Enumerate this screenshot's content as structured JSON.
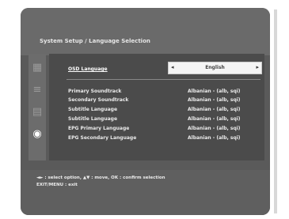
{
  "title": "System Setup / Language Selection",
  "main_setting": {
    "label": "OSD Language",
    "value": "English",
    "left_arrow": "◂",
    "right_arrow": "▸"
  },
  "settings": [
    {
      "label": "Primary Soundtrack",
      "value": "Albanian - (alb, sqi)"
    },
    {
      "label": "Secondary Soundtrack",
      "value": "Albanian - (alb, sqi)"
    },
    {
      "label": "Subtitle Language",
      "value": "Albanian - (alb, sqi)"
    },
    {
      "label": "Subtitle Language",
      "value": "Albanian - (alb, sqi)"
    },
    {
      "label": "EPG Primary Language",
      "value": "Albanian - (alb, sqi)"
    },
    {
      "label": "EPG Secondary Language",
      "value": "Albanian - (alb, sqi)"
    }
  ],
  "sidebar_icons": [
    "settings-icon",
    "menu-icon",
    "display-icon",
    "language-icon"
  ],
  "sidebar_glyphs": [
    "▦",
    "≡",
    "▤",
    "◉"
  ],
  "help": {
    "line1": "◄► : select option, ▲▼ : move, OK : confirm selection",
    "line2": "EXIT/MENU : exit"
  },
  "colors": {
    "background": "#5a5a5a",
    "content": "#4b4b4b",
    "select_bg": "#f4f4f4",
    "text": "#eaeaea"
  }
}
